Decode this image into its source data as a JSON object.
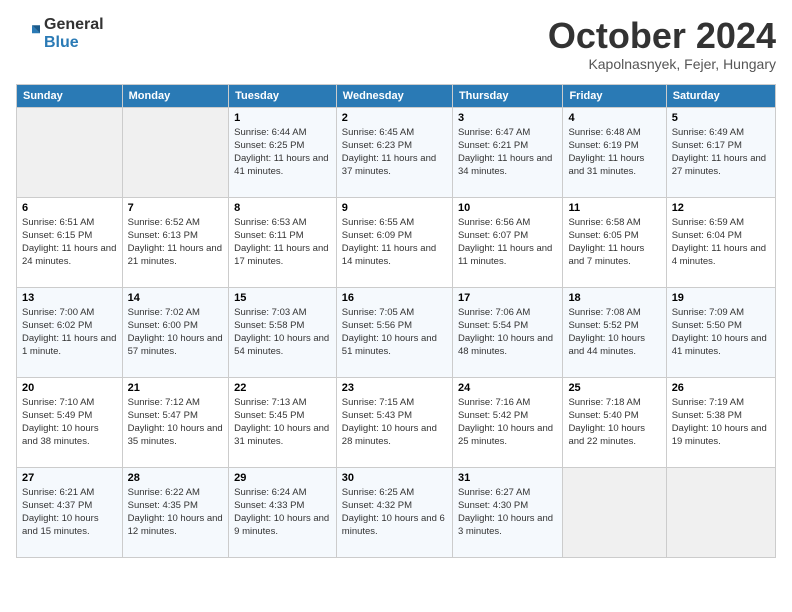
{
  "logo": {
    "general": "General",
    "blue": "Blue"
  },
  "header": {
    "month": "October 2024",
    "location": "Kapolnasnyek, Fejer, Hungary"
  },
  "weekdays": [
    "Sunday",
    "Monday",
    "Tuesday",
    "Wednesday",
    "Thursday",
    "Friday",
    "Saturday"
  ],
  "rows": [
    [
      {
        "day": "",
        "empty": true
      },
      {
        "day": "",
        "empty": true
      },
      {
        "day": "1",
        "sunrise": "6:44 AM",
        "sunset": "6:25 PM",
        "daylight": "11 hours and 41 minutes."
      },
      {
        "day": "2",
        "sunrise": "6:45 AM",
        "sunset": "6:23 PM",
        "daylight": "11 hours and 37 minutes."
      },
      {
        "day": "3",
        "sunrise": "6:47 AM",
        "sunset": "6:21 PM",
        "daylight": "11 hours and 34 minutes."
      },
      {
        "day": "4",
        "sunrise": "6:48 AM",
        "sunset": "6:19 PM",
        "daylight": "11 hours and 31 minutes."
      },
      {
        "day": "5",
        "sunrise": "6:49 AM",
        "sunset": "6:17 PM",
        "daylight": "11 hours and 27 minutes."
      }
    ],
    [
      {
        "day": "6",
        "sunrise": "6:51 AM",
        "sunset": "6:15 PM",
        "daylight": "11 hours and 24 minutes."
      },
      {
        "day": "7",
        "sunrise": "6:52 AM",
        "sunset": "6:13 PM",
        "daylight": "11 hours and 21 minutes."
      },
      {
        "day": "8",
        "sunrise": "6:53 AM",
        "sunset": "6:11 PM",
        "daylight": "11 hours and 17 minutes."
      },
      {
        "day": "9",
        "sunrise": "6:55 AM",
        "sunset": "6:09 PM",
        "daylight": "11 hours and 14 minutes."
      },
      {
        "day": "10",
        "sunrise": "6:56 AM",
        "sunset": "6:07 PM",
        "daylight": "11 hours and 11 minutes."
      },
      {
        "day": "11",
        "sunrise": "6:58 AM",
        "sunset": "6:05 PM",
        "daylight": "11 hours and 7 minutes."
      },
      {
        "day": "12",
        "sunrise": "6:59 AM",
        "sunset": "6:04 PM",
        "daylight": "11 hours and 4 minutes."
      }
    ],
    [
      {
        "day": "13",
        "sunrise": "7:00 AM",
        "sunset": "6:02 PM",
        "daylight": "11 hours and 1 minute."
      },
      {
        "day": "14",
        "sunrise": "7:02 AM",
        "sunset": "6:00 PM",
        "daylight": "10 hours and 57 minutes."
      },
      {
        "day": "15",
        "sunrise": "7:03 AM",
        "sunset": "5:58 PM",
        "daylight": "10 hours and 54 minutes."
      },
      {
        "day": "16",
        "sunrise": "7:05 AM",
        "sunset": "5:56 PM",
        "daylight": "10 hours and 51 minutes."
      },
      {
        "day": "17",
        "sunrise": "7:06 AM",
        "sunset": "5:54 PM",
        "daylight": "10 hours and 48 minutes."
      },
      {
        "day": "18",
        "sunrise": "7:08 AM",
        "sunset": "5:52 PM",
        "daylight": "10 hours and 44 minutes."
      },
      {
        "day": "19",
        "sunrise": "7:09 AM",
        "sunset": "5:50 PM",
        "daylight": "10 hours and 41 minutes."
      }
    ],
    [
      {
        "day": "20",
        "sunrise": "7:10 AM",
        "sunset": "5:49 PM",
        "daylight": "10 hours and 38 minutes."
      },
      {
        "day": "21",
        "sunrise": "7:12 AM",
        "sunset": "5:47 PM",
        "daylight": "10 hours and 35 minutes."
      },
      {
        "day": "22",
        "sunrise": "7:13 AM",
        "sunset": "5:45 PM",
        "daylight": "10 hours and 31 minutes."
      },
      {
        "day": "23",
        "sunrise": "7:15 AM",
        "sunset": "5:43 PM",
        "daylight": "10 hours and 28 minutes."
      },
      {
        "day": "24",
        "sunrise": "7:16 AM",
        "sunset": "5:42 PM",
        "daylight": "10 hours and 25 minutes."
      },
      {
        "day": "25",
        "sunrise": "7:18 AM",
        "sunset": "5:40 PM",
        "daylight": "10 hours and 22 minutes."
      },
      {
        "day": "26",
        "sunrise": "7:19 AM",
        "sunset": "5:38 PM",
        "daylight": "10 hours and 19 minutes."
      }
    ],
    [
      {
        "day": "27",
        "sunrise": "6:21 AM",
        "sunset": "4:37 PM",
        "daylight": "10 hours and 15 minutes."
      },
      {
        "day": "28",
        "sunrise": "6:22 AM",
        "sunset": "4:35 PM",
        "daylight": "10 hours and 12 minutes."
      },
      {
        "day": "29",
        "sunrise": "6:24 AM",
        "sunset": "4:33 PM",
        "daylight": "10 hours and 9 minutes."
      },
      {
        "day": "30",
        "sunrise": "6:25 AM",
        "sunset": "4:32 PM",
        "daylight": "10 hours and 6 minutes."
      },
      {
        "day": "31",
        "sunrise": "6:27 AM",
        "sunset": "4:30 PM",
        "daylight": "10 hours and 3 minutes."
      },
      {
        "day": "",
        "empty": true
      },
      {
        "day": "",
        "empty": true
      }
    ]
  ],
  "labels": {
    "sunrise": "Sunrise:",
    "sunset": "Sunset:",
    "daylight": "Daylight:"
  }
}
